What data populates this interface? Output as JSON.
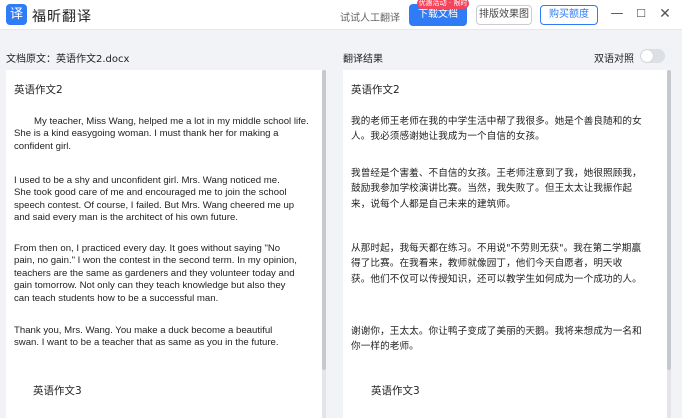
{
  "titlebar": {
    "logo_char": "译",
    "app_name": "福昕翻译",
    "trial_label": "试试人工翻译",
    "download_label": "下载文档",
    "promo_badge": "优惠活动 · 限时",
    "compare_label": "排版效果图",
    "buy_label": "购买额度",
    "minimize_glyph": "—",
    "maximize_glyph": "☐",
    "close_glyph": "✕"
  },
  "left_panel": {
    "header": "文档原文：英语作文2.docx",
    "heading1": "英语作文2",
    "paragraphs": [
      "My teacher, Miss Wang, helped me a lot in my middle school life.\nShe is a kind easygoing woman. I must thank her for making a\nconfident girl.",
      "I used to be a shy and unconfident girl. Mrs. Wang noticed me.\nShe took good care of me and encouraged me to join the school\nspeech contest. Of course, I failed. But Mrs. Wang cheered me up\nand said every man is the architect of his own future.",
      "From then on, I practiced every day. It goes without saying \"No\npain, no gain.\" I won the contest in the second term. In my opinion,\nteachers are the same as gardeners and they volunteer today and\ngain tomorrow. Not only can they teach knowledge but also they\ncan teach students how to be a successful man.",
      "Thank you, Mrs. Wang. You make a duck become a beautiful\nswan. I want to be a teacher that as same as you in the future."
    ],
    "heading2": "英语作文3"
  },
  "right_panel": {
    "header": "翻译结果",
    "toggle_label": "双语对照",
    "toggle_on": false,
    "heading1": "英语作文2",
    "paragraphs": [
      "我的老师王老师在我的中学生活中帮了我很多。她是个善良随和的女\n人。我必须感谢她让我成为一个自信的女孩。",
      "我曾经是个害羞、不自信的女孩。王老师注意到了我，她很照顾我，\n鼓励我参加学校演讲比赛。当然，我失败了。但王太太让我振作起\n来，说每个人都是自己未来的建筑师。",
      "从那时起，我每天都在练习。不用说\"不劳则无获\"。我在第二学期赢\n得了比赛。在我看来，教师就像园丁，他们今天自愿者，明天收\n获。他们不仅可以传授知识，还可以教学生如何成为一个成功的人。",
      "谢谢你，王太太。你让鸭子变成了美丽的天鹅。我将来想成为一名和\n你一样的老师。"
    ],
    "heading2": "英语作文3"
  },
  "colors": {
    "accent": "#2f7cf6",
    "promo": "#f5455b",
    "background": "#f1f3f6"
  }
}
